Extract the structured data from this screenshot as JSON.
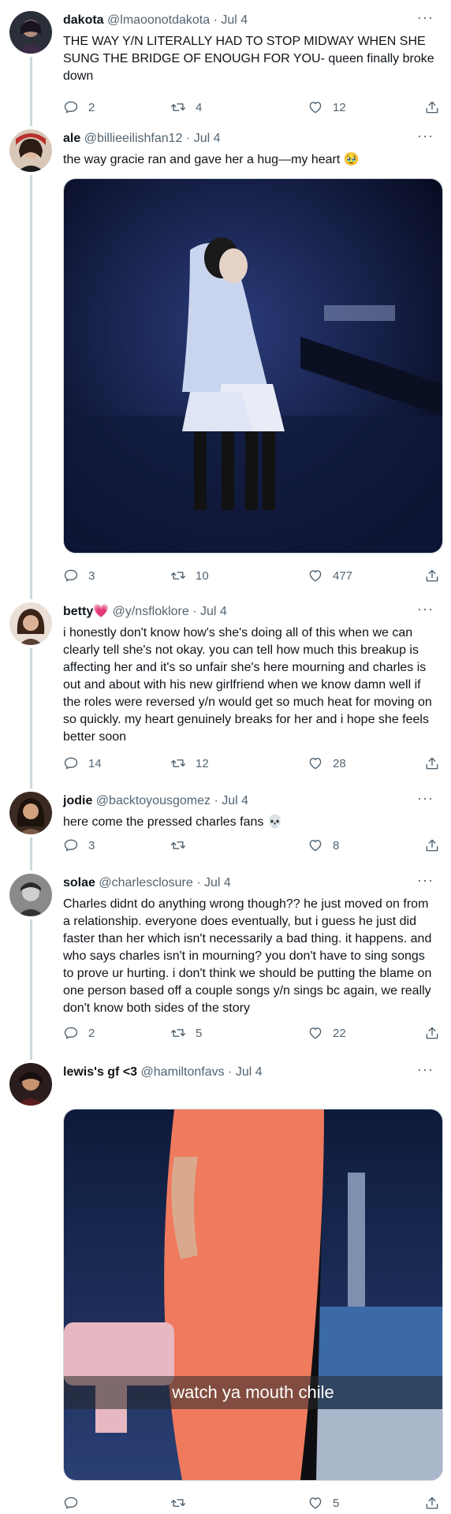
{
  "tweets": [
    {
      "name": "dakota",
      "badge": "",
      "handle": "@lmaoonotdakota",
      "date": "· Jul 4",
      "text": "THE WAY Y/N LITERALLY HAD TO STOP MIDWAY WHEN SHE SUNG THE BRIDGE OF ENOUGH FOR YOU- queen finally broke down",
      "replies": "2",
      "retweets": "4",
      "likes": "12"
    },
    {
      "name": "ale",
      "badge": "",
      "handle": "@billieeilishfan12",
      "date": "· Jul 4",
      "text": "the way gracie ran and gave her a hug—my heart 🥹",
      "replies": "3",
      "retweets": "10",
      "likes": "477"
    },
    {
      "name": "betty",
      "badge": "💗",
      "handle": "@y/nsfloklore",
      "date": "· Jul 4",
      "text": "i honestly don't know how's she's doing all of this when we can clearly tell she's not okay. you can tell how much this breakup is affecting her and  it's so unfair she's here mourning and charles is out and about with his new girlfriend when we know damn well if the roles were reversed y/n would get so much heat for moving on so quickly. my heart genuinely breaks for her and i hope she feels better soon",
      "replies": "14",
      "retweets": "12",
      "likes": "28"
    },
    {
      "name": "jodie",
      "badge": "",
      "handle": "@backtoyousgomez",
      "date": "· Jul 4",
      "text": "here come the pressed charles fans 💀",
      "replies": "3",
      "retweets": "",
      "likes": "8"
    },
    {
      "name": "solae",
      "badge": "",
      "handle": "@charlesclosure",
      "date": "· Jul 4",
      "text": "Charles didnt do anything wrong though?? he just moved on from a relationship. everyone does eventually, but i guess he just did faster than her which isn't necessarily a bad thing. it happens. and who says charles isn't in mourning? you don't have to sing songs to prove ur hurting. i don't think we should be putting the blame on one person based off a couple songs y/n sings bc again, we really don't know both sides of the story",
      "replies": "2",
      "retweets": "5",
      "likes": "22"
    },
    {
      "name": "lewis's gf <3",
      "badge": "",
      "handle": "@hamiltonfavs",
      "date": "· Jul 4",
      "text": "",
      "media_caption": "watch ya mouth chile",
      "replies": "",
      "retweets": "",
      "likes": "5"
    }
  ],
  "more_label": "···",
  "colors": {
    "secondary": "#536471",
    "line": "#cfd9de",
    "text": "#0f1419"
  }
}
